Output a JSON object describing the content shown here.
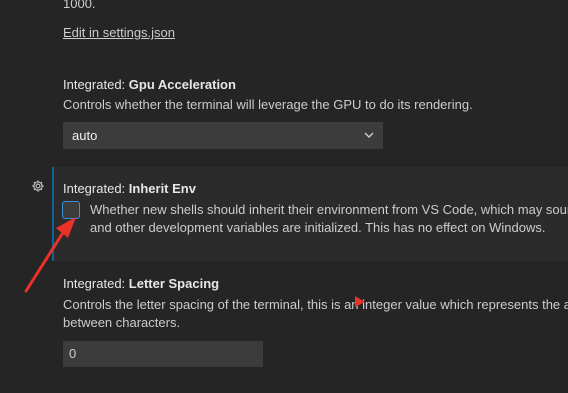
{
  "top_fragment": "1000.",
  "edit_link": "Edit in settings.json",
  "gpu": {
    "category": "Integrated: ",
    "name": "Gpu Acceleration",
    "description": "Controls whether the terminal will leverage the GPU to do its rendering.",
    "value": "auto"
  },
  "inherit_env": {
    "category": "Integrated: ",
    "name": "Inherit Env",
    "description_line1": "Whether new shells should inherit their environment from VS Code, which may sour",
    "description_line2": "and other development variables are initialized. This has no effect on Windows.",
    "checked": false
  },
  "letter_spacing": {
    "category": "Integrated: ",
    "name": "Letter Spacing",
    "description_line1": "Controls the letter spacing of the terminal, this is an integer value which represents the a",
    "description_line2": "between characters.",
    "value": "0"
  },
  "colors": {
    "background": "#252526",
    "focus_border": "#0e639c",
    "annotation_red": "#e8322a"
  }
}
